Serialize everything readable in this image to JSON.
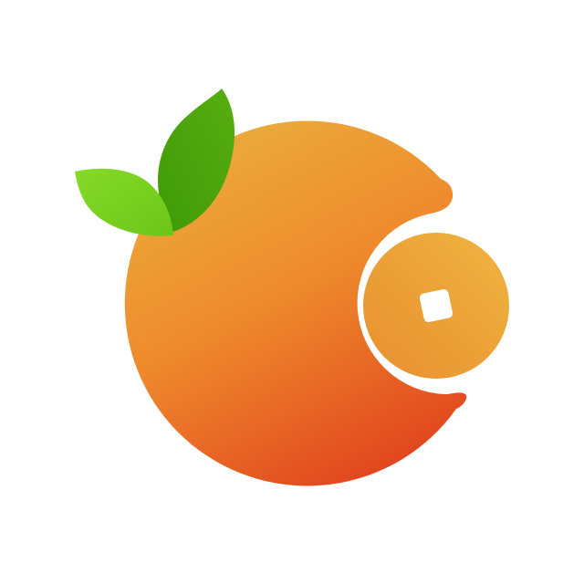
{
  "logo": {
    "name": "orange-with-coin-logo",
    "colors": {
      "background": "#ffffff",
      "orange_light": "#EBA93A",
      "orange_mid": "#EE8A2C",
      "orange_dark": "#E2481F",
      "coin_light": "#EFB441",
      "coin_dark": "#E88F2E",
      "leaf_dark": "#4FA80C",
      "leaf_light": "#7CD41F",
      "hole": "#ffffff"
    },
    "icons": [
      "orange-fruit-icon",
      "leaf-icon",
      "coin-icon",
      "square-hole-icon"
    ]
  }
}
